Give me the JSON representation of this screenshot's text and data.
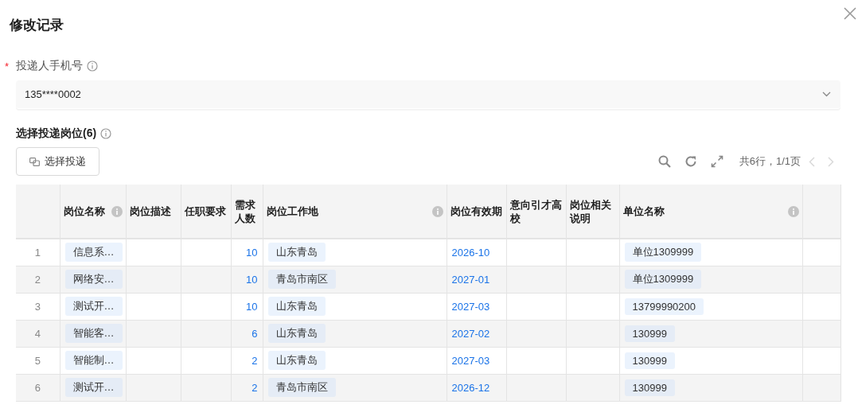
{
  "dialog": {
    "title": "修改记录"
  },
  "phone_field": {
    "label": "投递人手机号",
    "required_mark": "*",
    "value": "135****0002"
  },
  "positions": {
    "label": "选择投递岗位(6)",
    "button": "选择投递",
    "summary": "共6行，1/1页",
    "prev_disabled": true,
    "next_disabled": true,
    "columns": [
      {},
      {
        "label": "岗位名称",
        "info": true
      },
      {
        "label": "岗位描述"
      },
      {
        "label": "任职要求"
      },
      {
        "label": "需求人数"
      },
      {
        "label": "岗位工作地",
        "info": true
      },
      {
        "label": "岗位有效期"
      },
      {
        "label": "意向引才高校"
      },
      {
        "label": "岗位相关说明"
      },
      {
        "label": "单位名称",
        "info": true
      },
      {}
    ],
    "rows": [
      {
        "index": "1",
        "position": "信息系…",
        "count": "10",
        "location": "山东青岛",
        "validity": "2026-10",
        "unit": "单位1309999"
      },
      {
        "index": "2",
        "position": "网络安…",
        "count": "10",
        "location": "青岛市南区",
        "validity": "2027-01",
        "unit": "单位1309999"
      },
      {
        "index": "3",
        "position": "测试开…",
        "count": "10",
        "location": "山东青岛",
        "validity": "2027-03",
        "unit": "13799990200"
      },
      {
        "index": "4",
        "position": "智能客…",
        "count": "6",
        "location": "山东青岛",
        "validity": "2027-02",
        "unit": "130999"
      },
      {
        "index": "5",
        "position": "智能制…",
        "count": "2",
        "location": "山东青岛",
        "validity": "2027-03",
        "unit": "130999"
      },
      {
        "index": "6",
        "position": "测试开…",
        "count": "2",
        "location": "青岛市南区",
        "validity": "2026-12",
        "unit": "130999"
      }
    ]
  }
}
